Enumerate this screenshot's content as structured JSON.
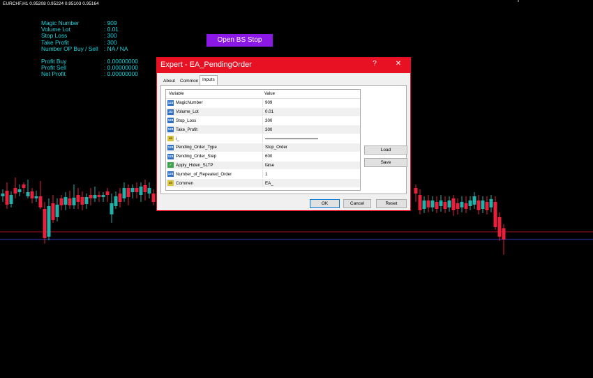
{
  "chart": {
    "symbol": "EURCHF,H1  0.95208 0.95224 0.95103 0.95164",
    "colors": {
      "background": "#000000",
      "bull": "#20b2aa",
      "bear": "#e8203c",
      "line_red": "#b01020",
      "line_blue": "#3040c0"
    }
  },
  "info": {
    "rows": [
      {
        "label": "Magic Number",
        "value": ": 909"
      },
      {
        "label": "Volume Lot",
        "value": ": 0.01"
      },
      {
        "label": "Stop Loss",
        "value": ": 300"
      },
      {
        "label": "Take Profit",
        "value": ": 300"
      },
      {
        "label": "Number OP Buy / Sell",
        "value": ": NA / NA"
      }
    ],
    "profit_rows": [
      {
        "label": "Profit Buy",
        "value": ": 0.00000000"
      },
      {
        "label": "Profit Sell",
        "value": ": 0.00000000"
      },
      {
        "label": "Net Profit",
        "value": ": 0.00000000"
      }
    ]
  },
  "open_button": {
    "label": "Open BS Stop",
    "color": "#8c18e6"
  },
  "dialog": {
    "title": "Expert - EA_PendingOrder",
    "help_label": "?",
    "close_label": "✕",
    "accent": "#e81123",
    "tabs": [
      "About",
      "Common",
      "Inputs"
    ],
    "columns": {
      "variable": "Variable",
      "value": "Value"
    },
    "params": [
      {
        "name": "MagicNumber",
        "value": "909",
        "icon": "123"
      },
      {
        "name": "Volume_Lot",
        "value": "0.01",
        "icon": "1/2"
      },
      {
        "name": "Stop_Loss",
        "value": "300",
        "icon": "123"
      },
      {
        "name": "Take_Profit",
        "value": "300",
        "icon": "123"
      },
      {
        "name": "i_",
        "value": "",
        "icon": "ab"
      },
      {
        "name": "Pending_Order_Type",
        "value": "Stop_Order",
        "icon": "123"
      },
      {
        "name": "Pending_Order_Step",
        "value": "600",
        "icon": "123"
      },
      {
        "name": "Apply_Hiden_SLTP",
        "value": "false",
        "icon": "✓"
      },
      {
        "name": "Number_of_Repeated_Order",
        "value": "1",
        "icon": "123"
      },
      {
        "name": "Commen",
        "value": "EA_",
        "icon": "ab"
      }
    ],
    "load_label": "Load",
    "save_label": "Save",
    "ok_label": "OK",
    "cancel_label": "Cancel",
    "reset_label": "Reset"
  }
}
